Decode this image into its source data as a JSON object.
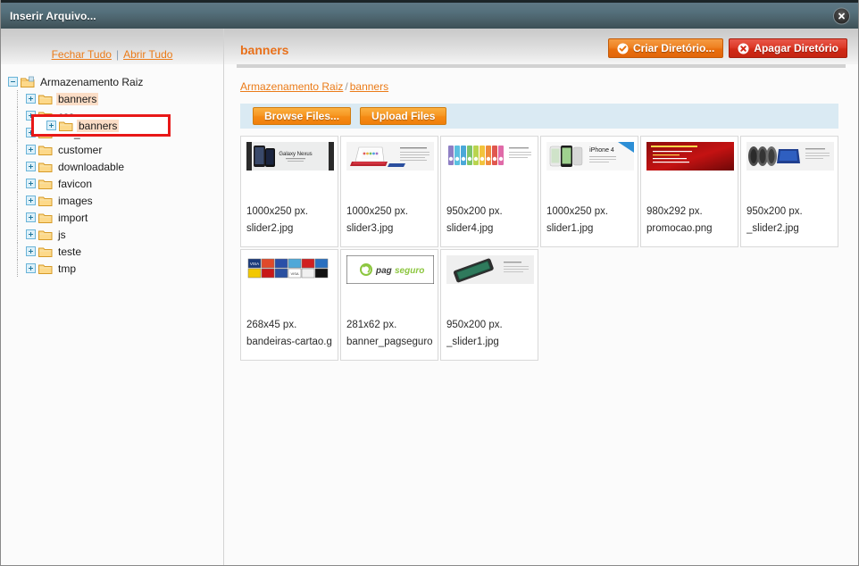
{
  "window": {
    "title": "Inserir Arquivo...",
    "close_icon": "close-icon"
  },
  "sidebar": {
    "collapse_all_label": "Fechar Tudo",
    "separator": "|",
    "expand_all_label": "Abrir Tudo",
    "tree": {
      "root": {
        "label": "Armazenamento Raiz",
        "state": "expanded",
        "icon": "root-folder-icon"
      },
      "items": [
        {
          "label": "banners",
          "state": "collapsed",
          "selected": true,
          "icon": "folder-icon"
        },
        {
          "label": "css",
          "state": "collapsed",
          "selected": false,
          "icon": "folder-icon"
        },
        {
          "label": "css_secure",
          "state": "collapsed",
          "selected": false,
          "icon": "folder-icon"
        },
        {
          "label": "customer",
          "state": "collapsed",
          "selected": false,
          "icon": "folder-icon"
        },
        {
          "label": "downloadable",
          "state": "collapsed",
          "selected": false,
          "icon": "folder-icon"
        },
        {
          "label": "favicon",
          "state": "collapsed",
          "selected": false,
          "icon": "folder-icon"
        },
        {
          "label": "images",
          "state": "collapsed",
          "selected": false,
          "icon": "folder-icon"
        },
        {
          "label": "import",
          "state": "collapsed",
          "selected": false,
          "icon": "folder-icon"
        },
        {
          "label": "js",
          "state": "collapsed",
          "selected": false,
          "icon": "folder-icon"
        },
        {
          "label": "teste",
          "state": "collapsed",
          "selected": false,
          "icon": "folder-icon"
        },
        {
          "label": "tmp",
          "state": "collapsed",
          "selected": false,
          "icon": "folder-icon"
        }
      ]
    }
  },
  "content": {
    "title": "banners",
    "create_dir_label": "Criar Diretório...",
    "create_dir_icon": "check-circle-icon",
    "delete_dir_label": "Apagar Diretório",
    "delete_dir_icon": "x-circle-icon",
    "breadcrumb": {
      "root_label": "Armazenamento Raiz",
      "separator": "/",
      "current_label": "banners"
    },
    "toolbar": {
      "browse_label": "Browse Files...",
      "upload_label": "Upload Files"
    },
    "files": [
      {
        "size": "1000x250 px.",
        "name": "slider2.jpg",
        "thumb": "galaxy-nexus-banner"
      },
      {
        "size": "1000x250 px.",
        "name": "slider3.jpg",
        "thumb": "laptop-banner"
      },
      {
        "size": "950x200 px.",
        "name": "slider4.jpg",
        "thumb": "ipod-colors-banner"
      },
      {
        "size": "1000x250 px.",
        "name": "slider1.jpg",
        "thumb": "iphone4s-banner"
      },
      {
        "size": "980x292 px.",
        "name": "promocao.png",
        "thumb": "promo-red-banner"
      },
      {
        "size": "950x200 px.",
        "name": "_slider2.jpg",
        "thumb": "laptop-blue-banner"
      },
      {
        "size": "268x45 px.",
        "name": "bandeiras-cartao.gif",
        "thumb": "credit-card-flags"
      },
      {
        "size": "281x62 px.",
        "name": "banner_pagseguro.gi",
        "thumb": "pagseguro-logo"
      },
      {
        "size": "950x200 px.",
        "name": "_slider1.jpg",
        "thumb": "phone-gray-banner"
      }
    ]
  },
  "colors": {
    "accent_orange": "#eb7b18",
    "danger_red": "#d22a17",
    "titlebar": "#4d646e",
    "selection_box": "#e81818",
    "selection_highlight": "#fbddc6",
    "toolbar_bg": "#daeaf3"
  }
}
